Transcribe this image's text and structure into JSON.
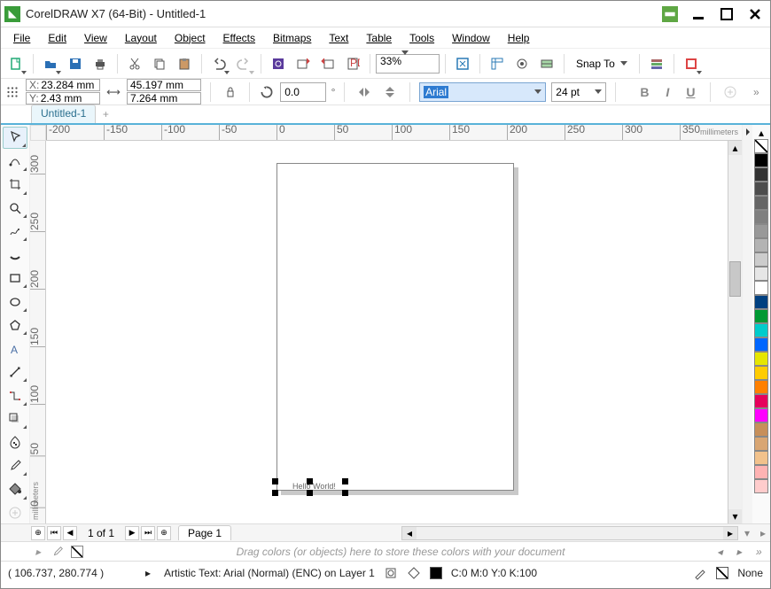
{
  "titlebar": {
    "app_icon_glyph": "◣",
    "title": "CorelDRAW X7 (64-Bit) - Untitled-1"
  },
  "menubar": {
    "items": [
      "File",
      "Edit",
      "View",
      "Layout",
      "Object",
      "Effects",
      "Bitmaps",
      "Text",
      "Table",
      "Tools",
      "Window",
      "Help"
    ]
  },
  "toolbar": {
    "zoom": "33%",
    "snap_label": "Snap To"
  },
  "propbar": {
    "x_label": "X:",
    "x_value": "23.284 mm",
    "y_label": "Y:",
    "y_value": "2.43 mm",
    "w_value": "45.197 mm",
    "h_value": "7.264 mm",
    "rotation": "0.0",
    "rotation_unit": "°",
    "font_name": "Arial",
    "font_size": "24 pt"
  },
  "doc_tabs": {
    "active": "Untitled-1"
  },
  "ruler": {
    "h_ticks": [
      {
        "pos": 0,
        "label": "-200"
      },
      {
        "pos": 65,
        "label": "-150"
      },
      {
        "pos": 130,
        "label": "-100"
      },
      {
        "pos": 195,
        "label": "-50"
      },
      {
        "pos": 260,
        "label": "0"
      },
      {
        "pos": 325,
        "label": "50"
      },
      {
        "pos": 390,
        "label": "100"
      },
      {
        "pos": 455,
        "label": "150"
      },
      {
        "pos": 520,
        "label": "200"
      },
      {
        "pos": 585,
        "label": "250"
      },
      {
        "pos": 650,
        "label": "300"
      },
      {
        "pos": 715,
        "label": "350"
      }
    ],
    "v_ticks": [
      {
        "pos": 16,
        "label": "300"
      },
      {
        "pos": 81,
        "label": "250"
      },
      {
        "pos": 146,
        "label": "200"
      },
      {
        "pos": 211,
        "label": "150"
      },
      {
        "pos": 276,
        "label": "100"
      },
      {
        "pos": 341,
        "label": "50"
      },
      {
        "pos": 406,
        "label": "0"
      }
    ],
    "unit": "millimeters"
  },
  "canvas": {
    "selected_text_hint": "Hello World!"
  },
  "palette_colors": [
    "none",
    "#000000",
    "#333333",
    "#4d4d4d",
    "#666666",
    "#808080",
    "#999999",
    "#b3b3b3",
    "#cccccc",
    "#e6e6e6",
    "#ffffff",
    "#004080",
    "#009933",
    "#00cccc",
    "#0066ff",
    "#e6e600",
    "#ffcc00",
    "#ff8000",
    "#e6005c",
    "#ff00ff",
    "#c78f5a",
    "#d9a673",
    "#f2c28c",
    "#ffb3b3",
    "#ffcccc"
  ],
  "page_nav": {
    "current": "1 of 1",
    "page_tab": "Page 1"
  },
  "swatch_dock": {
    "hint": "Drag colors (or objects) here to store these colors with your document"
  },
  "statusbar": {
    "coords": "( 106.737, 280.774 )",
    "object_desc": "Artistic Text: Arial (Normal) (ENC) on Layer 1",
    "fill": "C:0 M:0 Y:0 K:100",
    "outline": "None"
  }
}
